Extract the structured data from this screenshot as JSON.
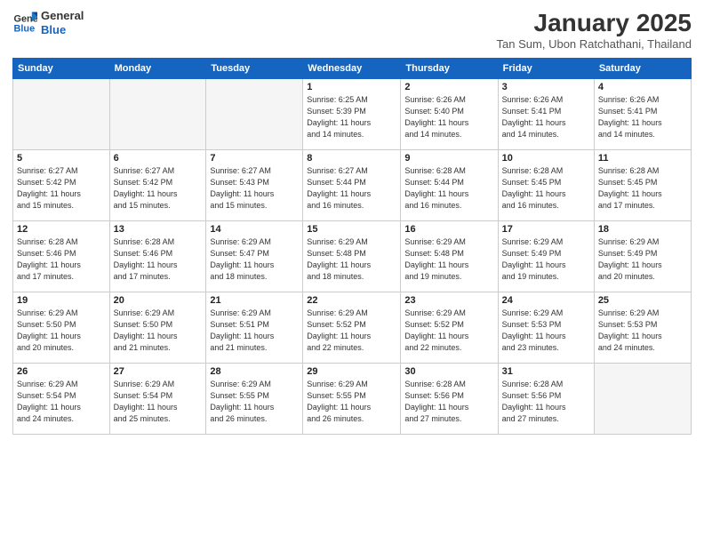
{
  "logo": {
    "line1": "General",
    "line2": "Blue"
  },
  "title": "January 2025",
  "subtitle": "Tan Sum, Ubon Ratchathani, Thailand",
  "days_of_week": [
    "Sunday",
    "Monday",
    "Tuesday",
    "Wednesday",
    "Thursday",
    "Friday",
    "Saturday"
  ],
  "weeks": [
    [
      {
        "num": "",
        "info": ""
      },
      {
        "num": "",
        "info": ""
      },
      {
        "num": "",
        "info": ""
      },
      {
        "num": "1",
        "info": "Sunrise: 6:25 AM\nSunset: 5:39 PM\nDaylight: 11 hours\nand 14 minutes."
      },
      {
        "num": "2",
        "info": "Sunrise: 6:26 AM\nSunset: 5:40 PM\nDaylight: 11 hours\nand 14 minutes."
      },
      {
        "num": "3",
        "info": "Sunrise: 6:26 AM\nSunset: 5:41 PM\nDaylight: 11 hours\nand 14 minutes."
      },
      {
        "num": "4",
        "info": "Sunrise: 6:26 AM\nSunset: 5:41 PM\nDaylight: 11 hours\nand 14 minutes."
      }
    ],
    [
      {
        "num": "5",
        "info": "Sunrise: 6:27 AM\nSunset: 5:42 PM\nDaylight: 11 hours\nand 15 minutes."
      },
      {
        "num": "6",
        "info": "Sunrise: 6:27 AM\nSunset: 5:42 PM\nDaylight: 11 hours\nand 15 minutes."
      },
      {
        "num": "7",
        "info": "Sunrise: 6:27 AM\nSunset: 5:43 PM\nDaylight: 11 hours\nand 15 minutes."
      },
      {
        "num": "8",
        "info": "Sunrise: 6:27 AM\nSunset: 5:44 PM\nDaylight: 11 hours\nand 16 minutes."
      },
      {
        "num": "9",
        "info": "Sunrise: 6:28 AM\nSunset: 5:44 PM\nDaylight: 11 hours\nand 16 minutes."
      },
      {
        "num": "10",
        "info": "Sunrise: 6:28 AM\nSunset: 5:45 PM\nDaylight: 11 hours\nand 16 minutes."
      },
      {
        "num": "11",
        "info": "Sunrise: 6:28 AM\nSunset: 5:45 PM\nDaylight: 11 hours\nand 17 minutes."
      }
    ],
    [
      {
        "num": "12",
        "info": "Sunrise: 6:28 AM\nSunset: 5:46 PM\nDaylight: 11 hours\nand 17 minutes."
      },
      {
        "num": "13",
        "info": "Sunrise: 6:28 AM\nSunset: 5:46 PM\nDaylight: 11 hours\nand 17 minutes."
      },
      {
        "num": "14",
        "info": "Sunrise: 6:29 AM\nSunset: 5:47 PM\nDaylight: 11 hours\nand 18 minutes."
      },
      {
        "num": "15",
        "info": "Sunrise: 6:29 AM\nSunset: 5:48 PM\nDaylight: 11 hours\nand 18 minutes."
      },
      {
        "num": "16",
        "info": "Sunrise: 6:29 AM\nSunset: 5:48 PM\nDaylight: 11 hours\nand 19 minutes."
      },
      {
        "num": "17",
        "info": "Sunrise: 6:29 AM\nSunset: 5:49 PM\nDaylight: 11 hours\nand 19 minutes."
      },
      {
        "num": "18",
        "info": "Sunrise: 6:29 AM\nSunset: 5:49 PM\nDaylight: 11 hours\nand 20 minutes."
      }
    ],
    [
      {
        "num": "19",
        "info": "Sunrise: 6:29 AM\nSunset: 5:50 PM\nDaylight: 11 hours\nand 20 minutes."
      },
      {
        "num": "20",
        "info": "Sunrise: 6:29 AM\nSunset: 5:50 PM\nDaylight: 11 hours\nand 21 minutes."
      },
      {
        "num": "21",
        "info": "Sunrise: 6:29 AM\nSunset: 5:51 PM\nDaylight: 11 hours\nand 21 minutes."
      },
      {
        "num": "22",
        "info": "Sunrise: 6:29 AM\nSunset: 5:52 PM\nDaylight: 11 hours\nand 22 minutes."
      },
      {
        "num": "23",
        "info": "Sunrise: 6:29 AM\nSunset: 5:52 PM\nDaylight: 11 hours\nand 22 minutes."
      },
      {
        "num": "24",
        "info": "Sunrise: 6:29 AM\nSunset: 5:53 PM\nDaylight: 11 hours\nand 23 minutes."
      },
      {
        "num": "25",
        "info": "Sunrise: 6:29 AM\nSunset: 5:53 PM\nDaylight: 11 hours\nand 24 minutes."
      }
    ],
    [
      {
        "num": "26",
        "info": "Sunrise: 6:29 AM\nSunset: 5:54 PM\nDaylight: 11 hours\nand 24 minutes."
      },
      {
        "num": "27",
        "info": "Sunrise: 6:29 AM\nSunset: 5:54 PM\nDaylight: 11 hours\nand 25 minutes."
      },
      {
        "num": "28",
        "info": "Sunrise: 6:29 AM\nSunset: 5:55 PM\nDaylight: 11 hours\nand 26 minutes."
      },
      {
        "num": "29",
        "info": "Sunrise: 6:29 AM\nSunset: 5:55 PM\nDaylight: 11 hours\nand 26 minutes."
      },
      {
        "num": "30",
        "info": "Sunrise: 6:28 AM\nSunset: 5:56 PM\nDaylight: 11 hours\nand 27 minutes."
      },
      {
        "num": "31",
        "info": "Sunrise: 6:28 AM\nSunset: 5:56 PM\nDaylight: 11 hours\nand 27 minutes."
      },
      {
        "num": "",
        "info": ""
      }
    ]
  ]
}
